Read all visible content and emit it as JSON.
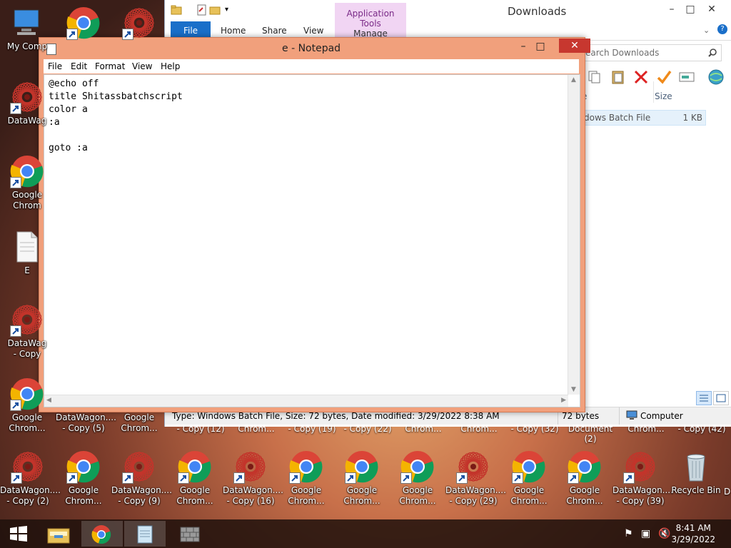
{
  "desktop": {
    "left_icons": [
      {
        "label": "My Comp",
        "kind": "computer"
      },
      {
        "label": "DataWag",
        "kind": "spiral"
      },
      {
        "label": "Google\nChrom",
        "kind": "chrome"
      },
      {
        "label": "E",
        "kind": "file"
      },
      {
        "label": "DataWag\n- Copy",
        "kind": "spiral"
      },
      {
        "label": "Google\nChrom...",
        "kind": "chrome"
      }
    ],
    "row2_labels": [
      "DataWagon....\n- Copy (5)",
      "Google\nChrom..."
    ],
    "partial_labels": [
      "- Copy (12)",
      "Chrom...",
      "- Copy (19)",
      "- Copy (22)",
      "Chrom...",
      "Chrom...",
      "- Copy (32)",
      "Document (2)",
      "Chrom...",
      "- Copy (42)"
    ],
    "bottom_icons": [
      {
        "label": "DataWagon....\n- Copy (2)",
        "kind": "spiral"
      },
      {
        "label": "Google\nChrom...",
        "kind": "chrome"
      },
      {
        "label": "DataWagon....\n- Copy (9)",
        "kind": "spiral"
      },
      {
        "label": "Google\nChrom...",
        "kind": "chrome"
      },
      {
        "label": "DataWagon....\n- Copy (16)",
        "kind": "spiral"
      },
      {
        "label": "Google\nChrom...",
        "kind": "chrome"
      },
      {
        "label": "Google\nChrom...",
        "kind": "chrome"
      },
      {
        "label": "Google\nChrom...",
        "kind": "chrome"
      },
      {
        "label": "DataWagon....\n- Copy (29)",
        "kind": "spiral"
      },
      {
        "label": "Google\nChrom...",
        "kind": "chrome"
      },
      {
        "label": "Google\nChrom...",
        "kind": "chrome"
      },
      {
        "label": "DataWagon....\n- Copy (39)",
        "kind": "spiral"
      },
      {
        "label": "Recycle Bin",
        "kind": "recycle"
      }
    ],
    "edge_label": "D"
  },
  "explorer": {
    "title": "Downloads",
    "context_tab": "Application Tools",
    "tabs": {
      "file": "File",
      "home": "Home",
      "share": "Share",
      "view": "View",
      "manage": "Manage"
    },
    "search_placeholder": "Search Downloads",
    "search_visible": "earch Downloads",
    "columns": {
      "type": "e",
      "size": "Size"
    },
    "file_row": {
      "type": "dows Batch File",
      "size": "1 KB"
    },
    "status": {
      "details": "Type: Windows Batch File, Size: 72 bytes, Date modified: 3/29/2022 8:38 AM",
      "size": "72 bytes",
      "location": "Computer"
    }
  },
  "notepad": {
    "title": "e - Notepad",
    "menu": {
      "file": "File",
      "edit": "Edit",
      "format": "Format",
      "view": "View",
      "help": "Help"
    },
    "content": "@echo off\ntitle Shitassbatchscript\ncolor a\n:a\n\ngoto :a"
  },
  "taskbar": {
    "time": "8:41 AM",
    "date": "3/29/2022"
  }
}
